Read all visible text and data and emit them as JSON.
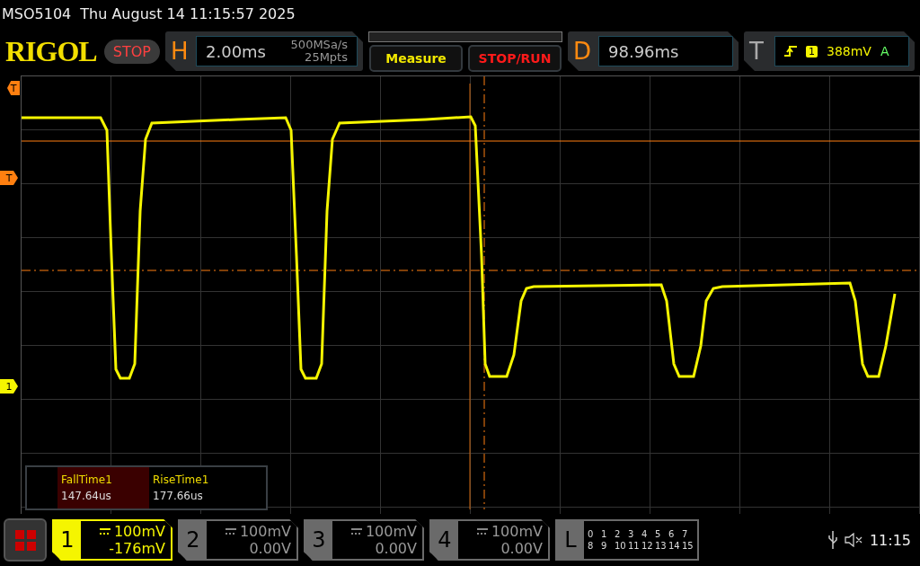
{
  "status_line": {
    "model": "MSO5104",
    "datetime": "Thu August 14 11:15:57 2025"
  },
  "brand": "RIGOL",
  "run_state": "STOP",
  "horizontal": {
    "label": "H",
    "timebase": "2.00ms",
    "sample_rate": "500MSa/s",
    "memory_depth": "25Mpts"
  },
  "buttons": [
    {
      "label": "Measure",
      "kind": "measure"
    },
    {
      "label": "STOP/RUN",
      "kind": "stoprun"
    }
  ],
  "delay": {
    "label": "D",
    "value": "98.96ms"
  },
  "trigger": {
    "label": "T",
    "source": "1",
    "level": "388mV",
    "mode": "A"
  },
  "side_markers": [
    {
      "label": "T",
      "kind": "trigger-position"
    },
    {
      "label": "T",
      "kind": "trigger-level"
    },
    {
      "label": "1",
      "kind": "channel"
    }
  ],
  "measurements": [
    {
      "name": "FallTime1",
      "value": "147.64us",
      "selected": true
    },
    {
      "name": "RiseTime1",
      "value": "177.66us",
      "selected": false
    }
  ],
  "channels": [
    {
      "number": "1",
      "scale": "100mV",
      "offset": "-176mV",
      "active": true
    },
    {
      "number": "2",
      "scale": "100mV",
      "offset": "0.00V",
      "active": false
    },
    {
      "number": "3",
      "scale": "100mV",
      "offset": "0.00V",
      "active": false
    },
    {
      "number": "4",
      "scale": "100mV",
      "offset": "0.00V",
      "active": false
    }
  ],
  "logic": {
    "label": "L",
    "rows": [
      [
        "0",
        "1",
        "2",
        "3",
        "4",
        "5",
        "6",
        "7"
      ],
      [
        "8",
        "9",
        "10",
        "11",
        "12",
        "13",
        "14",
        "15"
      ]
    ]
  },
  "clock": "11:15"
}
